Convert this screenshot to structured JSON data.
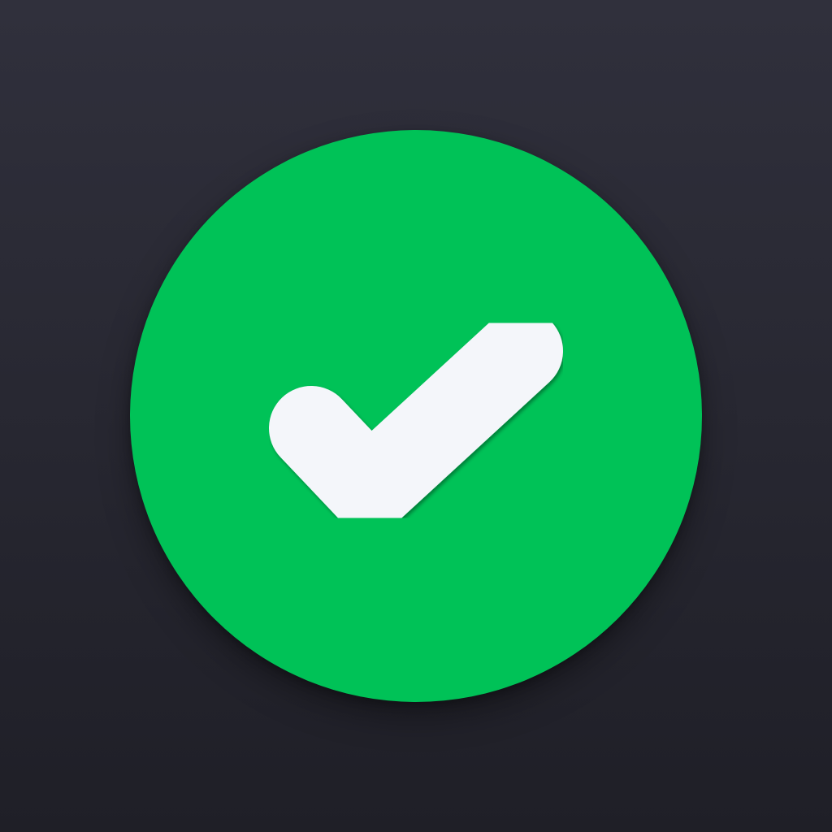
{
  "icon": {
    "name": "checkmark-icon",
    "status": "success"
  },
  "colors": {
    "background_top": "#30303c",
    "background_bottom": "#1f1f27",
    "badge": "#00c257",
    "checkmark": "#f4f6fa"
  }
}
